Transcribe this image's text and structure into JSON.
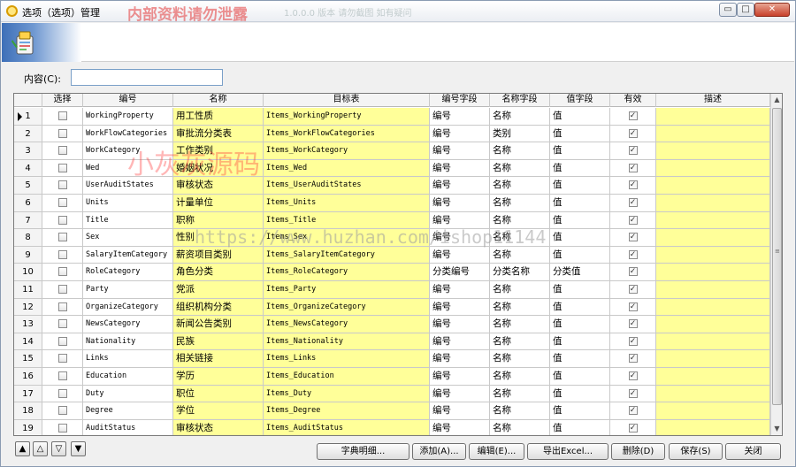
{
  "window": {
    "title": "选项（选项）管理",
    "close_glyph": "✕",
    "min_glyph": "▭",
    "max_glyph": "□"
  },
  "watermarks": {
    "top": "内部资料请勿泄露",
    "top_blur": "1.0.0.0 版本  请勿截图  如有疑问",
    "red": "小灰灰源码",
    "url": "https://www.huzhan.com/ishop11144"
  },
  "filter": {
    "label": "内容(C):",
    "value": ""
  },
  "grid": {
    "columns": [
      "选择",
      "编号",
      "名称",
      "目标表",
      "编号字段",
      "名称字段",
      "值字段",
      "有效",
      "描述"
    ],
    "rows": [
      {
        "n": "1",
        "code": "WorkingProperty",
        "name": "用工性质",
        "table": "Items_WorkingProperty",
        "code_field": "编号",
        "name_field": "名称",
        "value_field": "值",
        "valid": true,
        "desc": ""
      },
      {
        "n": "2",
        "code": "WorkFlowCategories",
        "name": "审批流分类表",
        "table": "Items_WorkFlowCategories",
        "code_field": "编号",
        "name_field": "类别",
        "value_field": "值",
        "valid": true,
        "desc": ""
      },
      {
        "n": "3",
        "code": "WorkCategory",
        "name": "工作类别",
        "table": "Items_WorkCategory",
        "code_field": "编号",
        "name_field": "名称",
        "value_field": "值",
        "valid": true,
        "desc": ""
      },
      {
        "n": "4",
        "code": "Wed",
        "name": "婚姻状况",
        "table": "Items_Wed",
        "code_field": "编号",
        "name_field": "名称",
        "value_field": "值",
        "valid": true,
        "desc": ""
      },
      {
        "n": "5",
        "code": "UserAuditStates",
        "name": "审核状态",
        "table": "Items_UserAuditStates",
        "code_field": "编号",
        "name_field": "名称",
        "value_field": "值",
        "valid": true,
        "desc": ""
      },
      {
        "n": "6",
        "code": "Units",
        "name": "计量单位",
        "table": "Items_Units",
        "code_field": "编号",
        "name_field": "名称",
        "value_field": "值",
        "valid": true,
        "desc": ""
      },
      {
        "n": "7",
        "code": "Title",
        "name": "职称",
        "table": "Items_Title",
        "code_field": "编号",
        "name_field": "名称",
        "value_field": "值",
        "valid": true,
        "desc": ""
      },
      {
        "n": "8",
        "code": "Sex",
        "name": "性别",
        "table": "Items_Sex",
        "code_field": "编号",
        "name_field": "名称",
        "value_field": "值",
        "valid": true,
        "desc": ""
      },
      {
        "n": "9",
        "code": "SalaryItemCategory",
        "name": "薪资项目类别",
        "table": "Items_SalaryItemCategory",
        "code_field": "编号",
        "name_field": "名称",
        "value_field": "值",
        "valid": true,
        "desc": ""
      },
      {
        "n": "10",
        "code": "RoleCategory",
        "name": "角色分类",
        "table": "Items_RoleCategory",
        "code_field": "分类编号",
        "name_field": "分类名称",
        "value_field": "分类值",
        "valid": true,
        "desc": ""
      },
      {
        "n": "11",
        "code": "Party",
        "name": "党派",
        "table": "Items_Party",
        "code_field": "编号",
        "name_field": "名称",
        "value_field": "值",
        "valid": true,
        "desc": ""
      },
      {
        "n": "12",
        "code": "OrganizeCategory",
        "name": "组织机构分类",
        "table": "Items_OrganizeCategory",
        "code_field": "编号",
        "name_field": "名称",
        "value_field": "值",
        "valid": true,
        "desc": ""
      },
      {
        "n": "13",
        "code": "NewsCategory",
        "name": "新闻公告类别",
        "table": "Items_NewsCategory",
        "code_field": "编号",
        "name_field": "名称",
        "value_field": "值",
        "valid": true,
        "desc": ""
      },
      {
        "n": "14",
        "code": "Nationality",
        "name": "民族",
        "table": "Items_Nationality",
        "code_field": "编号",
        "name_field": "名称",
        "value_field": "值",
        "valid": true,
        "desc": ""
      },
      {
        "n": "15",
        "code": "Links",
        "name": "相关链接",
        "table": "Items_Links",
        "code_field": "编号",
        "name_field": "名称",
        "value_field": "值",
        "valid": true,
        "desc": ""
      },
      {
        "n": "16",
        "code": "Education",
        "name": "学历",
        "table": "Items_Education",
        "code_field": "编号",
        "name_field": "名称",
        "value_field": "值",
        "valid": true,
        "desc": ""
      },
      {
        "n": "17",
        "code": "Duty",
        "name": "职位",
        "table": "Items_Duty",
        "code_field": "编号",
        "name_field": "名称",
        "value_field": "值",
        "valid": true,
        "desc": ""
      },
      {
        "n": "18",
        "code": "Degree",
        "name": "学位",
        "table": "Items_Degree",
        "code_field": "编号",
        "name_field": "名称",
        "value_field": "值",
        "valid": true,
        "desc": ""
      },
      {
        "n": "19",
        "code": "AuditStatus",
        "name": "审核状态",
        "table": "Items_AuditStatus",
        "code_field": "编号",
        "name_field": "名称",
        "value_field": "值",
        "valid": true,
        "desc": ""
      }
    ],
    "current_row_marker": "▶",
    "scroll_up_glyph": "▲",
    "scroll_down_glyph": "▼",
    "scroll_grip_glyph": "≡"
  },
  "nav": {
    "first": "▲",
    "prev": "△",
    "next": "▽",
    "last": "▼"
  },
  "actions": {
    "dictionary": "字典明细...",
    "add": "添加(A)...",
    "edit": "编辑(E)...",
    "export": "导出Excel...",
    "delete": "删除(D)",
    "save": "保存(S)",
    "close": "关闭"
  },
  "colors": {
    "yellow_cell": "#ffff99",
    "title_bg": "#ffffff",
    "close_button": "#c7402a"
  }
}
